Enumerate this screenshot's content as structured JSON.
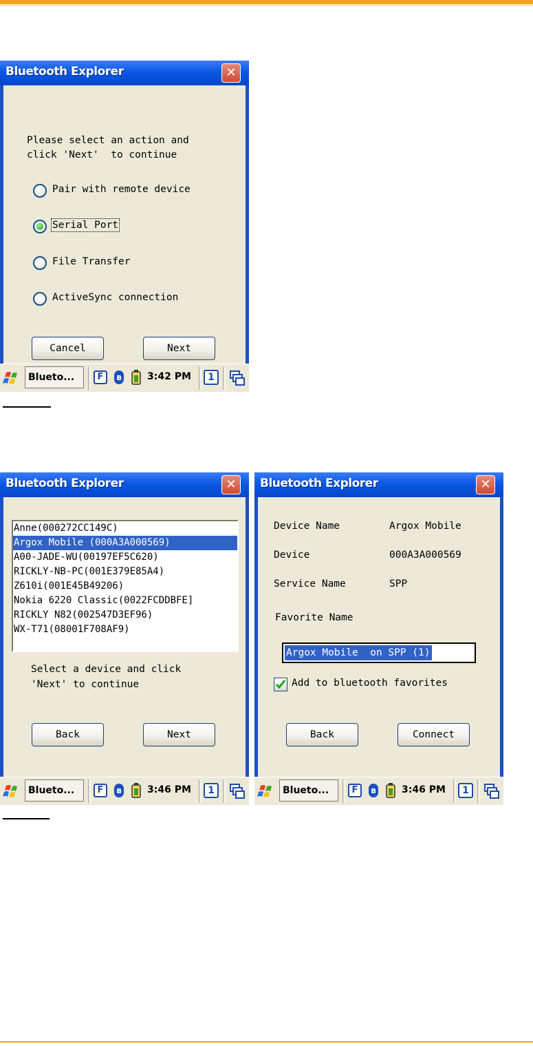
{
  "screen1": {
    "title": "Bluetooth Explorer",
    "close": "✕",
    "prompt_line1": "Please select an action and",
    "prompt_line2": "click 'Next'  to continue",
    "options": [
      {
        "label": "Pair with remote device",
        "selected": false
      },
      {
        "label": "Serial Port",
        "selected": true
      },
      {
        "label": "File Transfer",
        "selected": false
      },
      {
        "label": "ActiveSync connection",
        "selected": false
      }
    ],
    "cancel_label": "Cancel",
    "next_label": "Next",
    "taskbar": {
      "app": "Blueto...",
      "f_label": "F",
      "bt_label": "ʙ",
      "time": "3:42 PM",
      "num": "1"
    }
  },
  "screen2": {
    "title": "Bluetooth Explorer",
    "close": "✕",
    "devices": [
      {
        "label": "Anne(000272CC149C)",
        "selected": false
      },
      {
        "label": "Argox Mobile (000A3A000569)",
        "selected": true
      },
      {
        "label": "A00-JADE-WU(00197EF5C620)",
        "selected": false
      },
      {
        "label": "RICKLY-NB-PC(001E379E85A4)",
        "selected": false
      },
      {
        "label": "Z610i(001E45B49206)",
        "selected": false
      },
      {
        "label": "Nokia 6220 Classic(0022FCDDBFE]",
        "selected": false
      },
      {
        "label": "RICKLY N82(002547D3EF96)",
        "selected": false
      },
      {
        "label": "WX-T71(08001F708AF9)",
        "selected": false
      }
    ],
    "prompt_line1": "Select a device and click",
    "prompt_line2": "'Next' to continue",
    "back_label": "Back",
    "next_label": "Next",
    "taskbar": {
      "app": "Blueto...",
      "f_label": "F",
      "bt_label": "ʙ",
      "time": "3:46 PM",
      "num": "1"
    }
  },
  "screen3": {
    "title": "Bluetooth Explorer",
    "close": "✕",
    "device_name_label": "Device Name",
    "device_name_value": "Argox Mobile",
    "device_label": "Device",
    "device_value": "000A3A000569",
    "service_label": "Service Name",
    "service_value": "SPP",
    "favorite_label": "Favorite Name",
    "favorite_value": "Argox Mobile  on SPP (1)",
    "add_favorites_label": "Add to bluetooth favorites",
    "add_favorites_checked": true,
    "back_label": "Back",
    "connect_label": "Connect",
    "taskbar": {
      "app": "Blueto...",
      "f_label": "F",
      "bt_label": "ʙ",
      "time": "3:46 PM",
      "num": "1"
    }
  }
}
